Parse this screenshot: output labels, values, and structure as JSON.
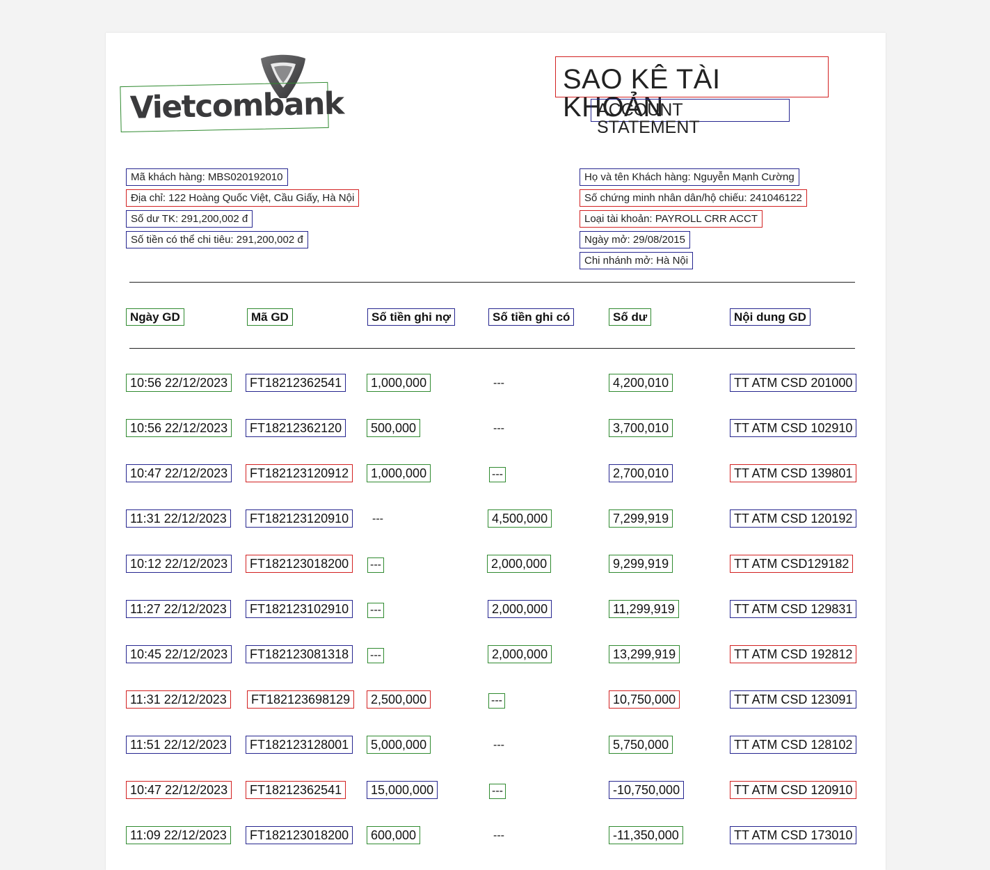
{
  "header": {
    "logo_text": "Vietcombank",
    "title": "SAO KÊ TÀI KHOẢN",
    "subtitle": "ACCOUNT STATEMENT"
  },
  "customer": {
    "ma_khach_hang": "Mã khách hàng:  MBS020192010",
    "dia_chi": "Địa chỉ: 122 Hoàng Quốc Việt, Cầu Giấy, Hà Nội",
    "so_du_tk": "Số dư TK: 291,200,002 đ",
    "so_tien_chi_tieu": "Số tiền có thể chi tiêu: 291,200,002 đ",
    "ho_ten": "Họ và tên Khách hàng: Nguyễn Mạnh Cường",
    "cmnd": "Số chứng minh nhân dân/hộ chiếu: 241046122",
    "loai_tk": "Loại tài khoản: PAYROLL CRR ACCT",
    "ngay_mo": "Ngày mở: 29/08/2015",
    "chi_nhanh": "Chi nhánh mở: Hà Nội"
  },
  "table": {
    "headers": [
      "Ngày GD",
      "Mã GD",
      "Số tiền ghi nợ",
      "Số tiền ghi có",
      "Số dư",
      "Nội dung GD"
    ],
    "rows": [
      [
        "10:56 22/12/2023",
        "FT18212362541",
        "1,000,000",
        "---",
        "4,200,010",
        "TT ATM CSD 201000"
      ],
      [
        "10:56 22/12/2023",
        "FT18212362120",
        "500,000",
        "---",
        "3,700,010",
        "TT ATM CSD 102910"
      ],
      [
        "10:47 22/12/2023",
        "FT182123120912",
        "1,000,000",
        "---",
        "2,700,010",
        "TT ATM CSD 139801"
      ],
      [
        "11:31 22/12/2023",
        "FT182123120910",
        "---",
        "4,500,000",
        "7,299,919",
        "TT ATM CSD 120192"
      ],
      [
        "10:12 22/12/2023",
        "FT182123018200",
        "---",
        "2,000,000",
        "9,299,919",
        "TT ATM CSD129182"
      ],
      [
        "11:27 22/12/2023",
        "FT182123102910",
        "---",
        "2,000,000",
        "11,299,919",
        "TT ATM CSD 129831"
      ],
      [
        "10:45 22/12/2023",
        "FT182123081318",
        "---",
        "2,000,000",
        "13,299,919",
        "TT ATM CSD 192812"
      ],
      [
        "11:31 22/12/2023",
        "FT182123698129",
        "2,500,000",
        "---",
        "10,750,000",
        "TT ATM CSD 123091"
      ],
      [
        "11:51 22/12/2023",
        "FT182123128001",
        "5,000,000",
        "---",
        "5,750,000",
        "TT ATM CSD 128102"
      ],
      [
        "10:47 22/12/2023",
        "FT18212362541",
        "15,000,000",
        "---",
        "-10,750,000",
        "TT ATM CSD 120910"
      ],
      [
        "11:09 22/12/2023",
        "FT182123018200",
        "600,000",
        "---",
        "-11,350,000",
        "TT ATM CSD 173010"
      ]
    ]
  },
  "colors": {
    "green_box": "#2f8a2f",
    "blue_box": "#25258f",
    "red_box": "#d22020",
    "logo_gray": "#3a3a3c"
  }
}
